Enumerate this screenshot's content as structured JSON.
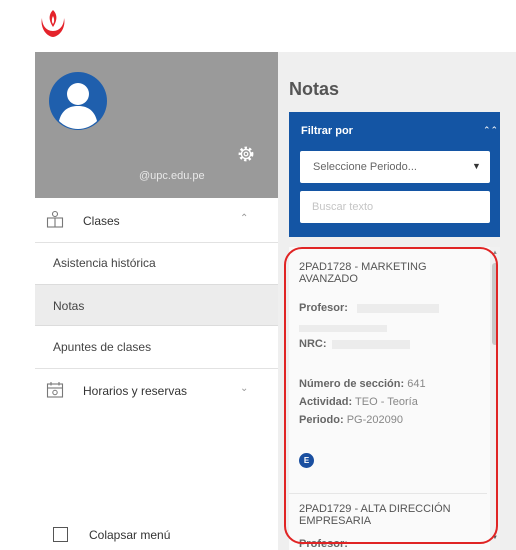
{
  "header": {
    "logo_icon": "upc-logo-icon",
    "brand_color": "#e4232b"
  },
  "sidebar": {
    "profile": {
      "email": "@upc.edu.pe",
      "avatar_icon": "user-avatar-icon",
      "settings_icon": "gear-icon",
      "bg_color": "#9a9a9a"
    },
    "sections": [
      {
        "label": "Clases",
        "icon": "classes-icon",
        "expanded": true,
        "items": [
          {
            "label": "Asistencia histórica",
            "active": false
          },
          {
            "label": "Notas",
            "active": true
          },
          {
            "label": "Apuntes de clases",
            "active": false
          }
        ]
      },
      {
        "label": "Horarios y reservas",
        "icon": "calendar-icon",
        "expanded": false,
        "items": []
      }
    ],
    "collapse_label": "Colapsar menú"
  },
  "main": {
    "title": "Notas",
    "filter": {
      "title": "Filtrar por",
      "period_select": "Seleccione Periodo...",
      "search_placeholder": "Buscar texto",
      "panel_color": "#1455a4"
    },
    "grades": [
      {
        "course": "2PAD1728 - MARKETING AVANZADO",
        "profesor_label": "Profesor:",
        "nrc_label": "NRC:",
        "seccion_label": "Número de sección:",
        "seccion_value": "641",
        "actividad_label": "Actividad:",
        "actividad_value": "TEO - Teoría",
        "periodo_label": "Periodo:",
        "periodo_value": "PG-202090",
        "badge": "E"
      },
      {
        "course": "2PAD1729 - ALTA DIRECCIÓN EMPRESARIA",
        "profesor_label": "Profesor:"
      }
    ]
  },
  "annotation": {
    "color": "#e02424"
  }
}
